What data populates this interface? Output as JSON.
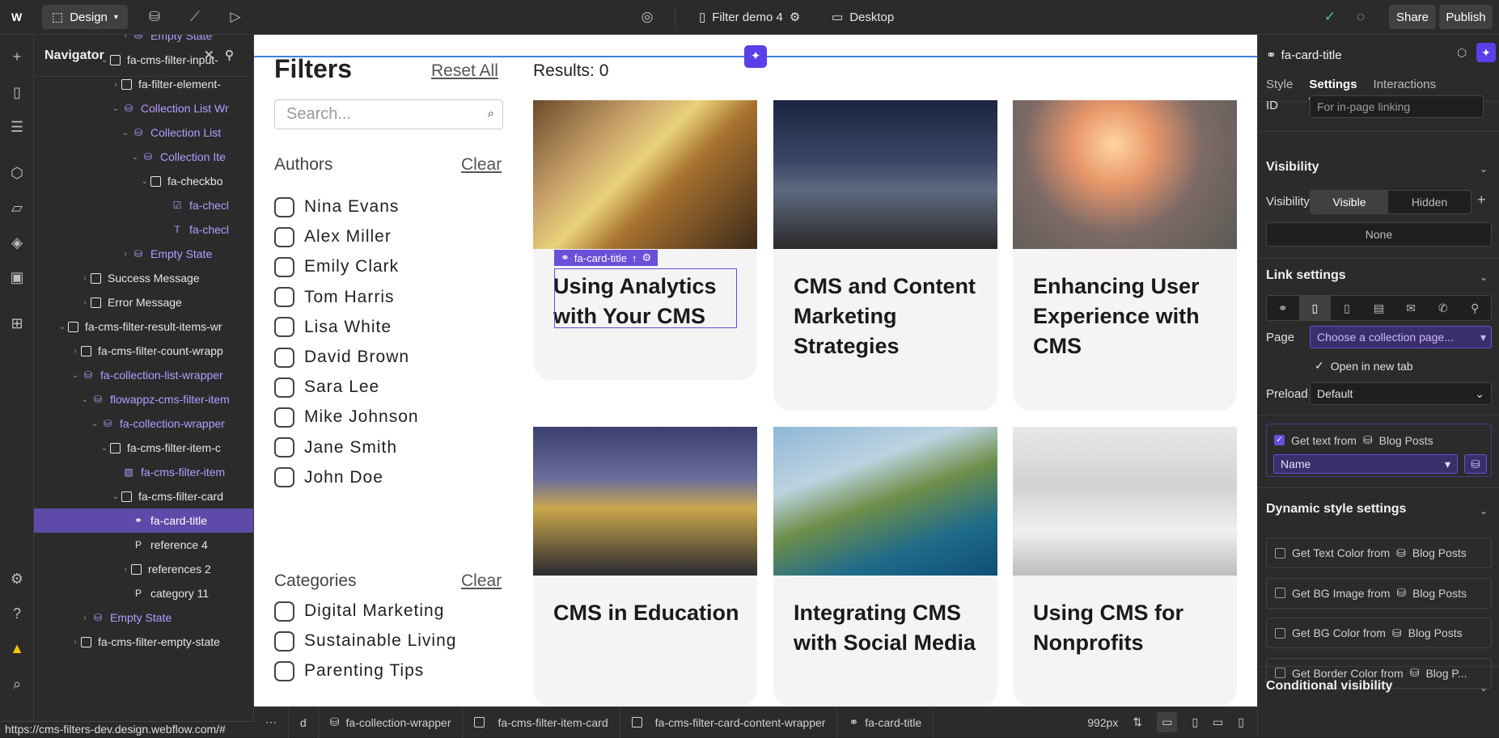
{
  "topbar": {
    "mode_label": "Design",
    "page_name": "Filter demo 4",
    "breakpoint_label": "Desktop",
    "share_label": "Share",
    "publish_label": "Publish"
  },
  "navigator": {
    "title": "Navigator",
    "items": [
      {
        "label": "Empty State",
        "type": "collection"
      },
      {
        "label": "fa-cms-filter-input-",
        "type": "box"
      },
      {
        "label": "fa-filter-element-",
        "type": "box"
      },
      {
        "label": "Collection List Wr",
        "type": "collection"
      },
      {
        "label": "Collection List",
        "type": "collection"
      },
      {
        "label": "Collection Ite",
        "type": "collection"
      },
      {
        "label": "fa-checkbo",
        "type": "box"
      },
      {
        "label": "fa-checl",
        "type": "check"
      },
      {
        "label": "fa-checl",
        "type": "text"
      },
      {
        "label": "Empty State",
        "type": "collection"
      },
      {
        "label": "Success Message",
        "type": "box"
      },
      {
        "label": "Error Message",
        "type": "box"
      },
      {
        "label": "fa-cms-filter-result-items-wr",
        "type": "box"
      },
      {
        "label": "fa-cms-filter-count-wrapp",
        "type": "box"
      },
      {
        "label": "fa-collection-list-wrapper",
        "type": "collection"
      },
      {
        "label": "flowappz-cms-filter-item",
        "type": "collection"
      },
      {
        "label": "fa-collection-wrapper",
        "type": "collection"
      },
      {
        "label": "fa-cms-filter-item-c",
        "type": "box"
      },
      {
        "label": "fa-cms-filter-item",
        "type": "image"
      },
      {
        "label": "fa-cms-filter-card",
        "type": "box"
      },
      {
        "label": "fa-card-title",
        "type": "link"
      },
      {
        "label": "reference 4",
        "type": "para"
      },
      {
        "label": "references 2",
        "type": "box"
      },
      {
        "label": "category 11",
        "type": "para"
      },
      {
        "label": "Empty State",
        "type": "collection"
      },
      {
        "label": "fa-cms-filter-empty-state",
        "type": "box"
      }
    ]
  },
  "canvas": {
    "filters_title": "Filters",
    "reset_label": "Reset All",
    "results_label": "Results: 0",
    "search_placeholder": "Search...",
    "authors_heading": "Authors",
    "clear_label": "Clear",
    "authors": [
      "Nina Evans",
      "Alex Miller",
      "Emily Clark",
      "Tom Harris",
      "Lisa White",
      "David Brown",
      "Sara Lee",
      "Mike Johnson",
      "Jane Smith",
      "John Doe"
    ],
    "categories_heading": "Categories",
    "categories": [
      "Digital Marketing",
      "Sustainable Living",
      "Parenting Tips"
    ],
    "selected_label": "fa-card-title",
    "cards": [
      {
        "title": "Using Analytics with Your CMS",
        "image": "tea-lemon-photo"
      },
      {
        "title": "CMS and Content Marketing Strategies",
        "image": "tent-night-photo"
      },
      {
        "title": "Enhancing User Experience with CMS",
        "image": "lantern-photo"
      },
      {
        "title": "CMS in Education",
        "image": "portland-sign-photo"
      },
      {
        "title": "Integrating CMS with Social Media",
        "image": "coast-photo"
      },
      {
        "title": "Using CMS for Nonprofits",
        "image": "cafe-interior-photo"
      }
    ]
  },
  "breadcrumbs": {
    "items": [
      "d",
      "fa-collection-wrapper",
      "fa-cms-filter-item-card",
      "fa-cms-filter-card-content-wrapper",
      "fa-card-title"
    ],
    "width_label": "992px"
  },
  "status_url": "https://cms-filters-dev.design.webflow.com/#",
  "panel": {
    "element_name": "fa-card-title",
    "tabs": [
      "Style",
      "Settings",
      "Interactions"
    ],
    "id_label": "ID",
    "id_placeholder": "For in-page linking",
    "visibility_heading": "Visibility",
    "visibility_label": "Visibility",
    "visible_label": "Visible",
    "hidden_label": "Hidden",
    "none_label": "None",
    "link_heading": "Link settings",
    "page_label": "Page",
    "page_value": "Choose a collection page...",
    "open_new_tab": "Open in new tab",
    "preload_label": "Preload",
    "preload_value": "Default",
    "get_text_label": "Get text from",
    "blog_posts": "Blog Posts",
    "name_value": "Name",
    "dynamic_heading": "Dynamic style settings",
    "dynamic_items": [
      "Get Text Color from",
      "Get BG Image from",
      "Get BG Color from",
      "Get Border Color from"
    ],
    "dynamic_sources": [
      "Blog Posts",
      "Blog Posts",
      "Blog Posts",
      "Blog P..."
    ],
    "conditional_heading": "Conditional visibility"
  },
  "colors": {
    "accent": "#5a40e8",
    "selection": "#6a4fd8"
  }
}
